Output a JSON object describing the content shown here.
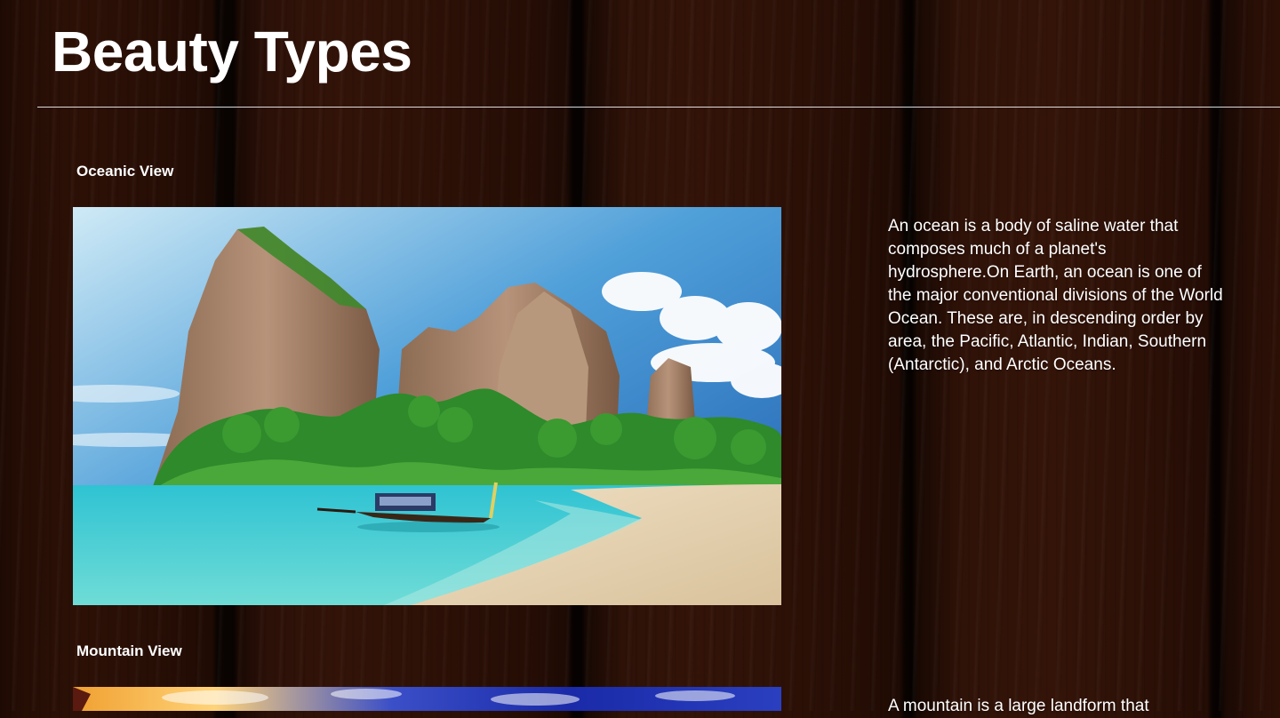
{
  "page": {
    "title": "Beauty Types"
  },
  "sections": [
    {
      "title": "Oceanic View",
      "image_icon": "tropical-beach-image",
      "description": "An ocean is a body of saline water that composes much of a planet's hydrosphere.On Earth, an ocean is one of the major conventional divisions of the World Ocean. These are, in descending order by area, the Pacific, Atlantic, Indian, Southern (Antarctic), and Arctic Oceans."
    },
    {
      "title": "Mountain View",
      "image_icon": "mountain-sunset-image",
      "description": "A mountain is a large landform that"
    }
  ],
  "colors": {
    "text": "#ffffff",
    "wood": "#6a4028"
  }
}
